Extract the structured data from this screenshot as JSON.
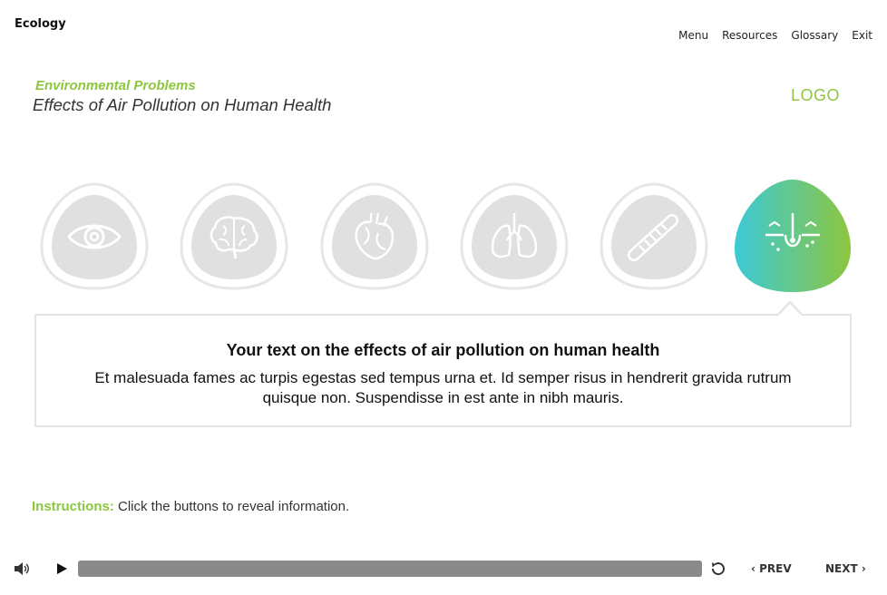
{
  "header": {
    "course_title": "Ecology",
    "nav": [
      "Menu",
      "Resources",
      "Glossary",
      "Exit"
    ]
  },
  "page": {
    "section_title": "Environmental Problems",
    "title": "Effects of Air Pollution on Human Health",
    "logo": "LOGO"
  },
  "topics": [
    {
      "icon": "eye-icon",
      "state": "inactive"
    },
    {
      "icon": "brain-icon",
      "state": "inactive"
    },
    {
      "icon": "heart-icon",
      "state": "inactive"
    },
    {
      "icon": "lungs-icon",
      "state": "inactive"
    },
    {
      "icon": "intestine-icon",
      "state": "inactive"
    },
    {
      "icon": "skin-icon",
      "state": "active"
    }
  ],
  "info": {
    "heading": "Your text on the effects of air pollution on human health",
    "body": "Et malesuada fames ac turpis egestas sed tempus urna et. Id semper risus in hendrerit gravida rutrum quisque non. Suspendisse in est ante in nibh mauris."
  },
  "instructions": {
    "label": "Instructions:",
    "text": "Click the buttons to reveal information."
  },
  "player": {
    "prev_label": "PREV",
    "next_label": "NEXT",
    "progress": 1.0
  },
  "colors": {
    "accent_green": "#8dc63f",
    "gradient_start": "#3cc9d6",
    "gradient_end": "#8dc63f",
    "inactive_fill": "#e0e0e0",
    "inactive_stroke": "#e6e6e6"
  }
}
